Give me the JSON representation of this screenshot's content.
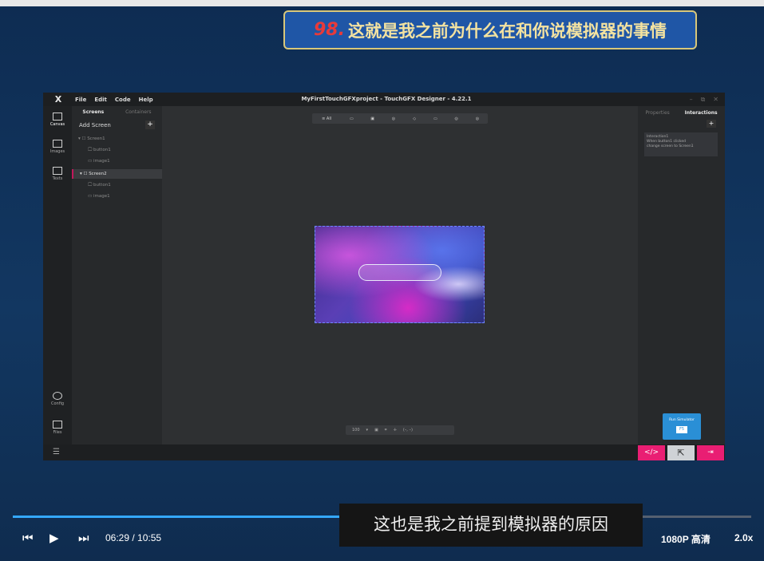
{
  "banner": {
    "number": "98.",
    "text": "这就是我之前为什么在和你说模拟器的事情"
  },
  "app": {
    "title": "MyFirstTouchGFXproject - TouchGFX Designer - 4.22.1",
    "logo": "X",
    "menu": [
      "File",
      "Edit",
      "Code",
      "Help"
    ],
    "window_controls": [
      "–",
      "⧉",
      "✕"
    ],
    "rail": [
      {
        "label": "Canvas",
        "icon": "canvas-icon"
      },
      {
        "label": "Images",
        "icon": "images-icon"
      },
      {
        "label": "Texts",
        "icon": "texts-icon"
      },
      {
        "label": "Config",
        "icon": "config-icon"
      },
      {
        "label": "Files",
        "icon": "files-icon"
      }
    ],
    "screens_panel": {
      "tabs": [
        "Screens",
        "Containers"
      ],
      "add_screen": "Add Screen",
      "add_symbol": "+",
      "tree": [
        {
          "label": "▾ ☐  Screen1",
          "indent": 0
        },
        {
          "label": "🖵 button1",
          "indent": 1
        },
        {
          "label": "▭ image1",
          "indent": 1
        },
        {
          "label": "▾ ☐  Screen2",
          "indent": 0
        },
        {
          "label": "🖵 button1",
          "indent": 1
        },
        {
          "label": "▭ image1",
          "indent": 1
        }
      ]
    },
    "toolbar": [
      "≡ All",
      "▭",
      "▣",
      "◎",
      "◇",
      "▭",
      "◎",
      "◎"
    ],
    "zoom": {
      "value": "100",
      "dropdown": "▾",
      "coords": "(–, –)"
    },
    "right_panel": {
      "tabs": [
        "Properties",
        "Interactions"
      ],
      "add_symbol": "+",
      "interaction": {
        "title": "Interaction1",
        "line1": "When button1 clicked",
        "line2": "change screen to Screen1"
      }
    },
    "run_simulator": {
      "label": "Run Simulator",
      "key": "F5"
    },
    "bottom": {
      "code_btn": "</>",
      "select_btn": "⇱",
      "exit_btn": "⇥"
    }
  },
  "player": {
    "time": "06:29 / 10:55",
    "progress": 0.593,
    "subtitle": "这也是我之前提到模拟器的原因",
    "quality": "1080P 高清",
    "speed": "2.0x"
  }
}
